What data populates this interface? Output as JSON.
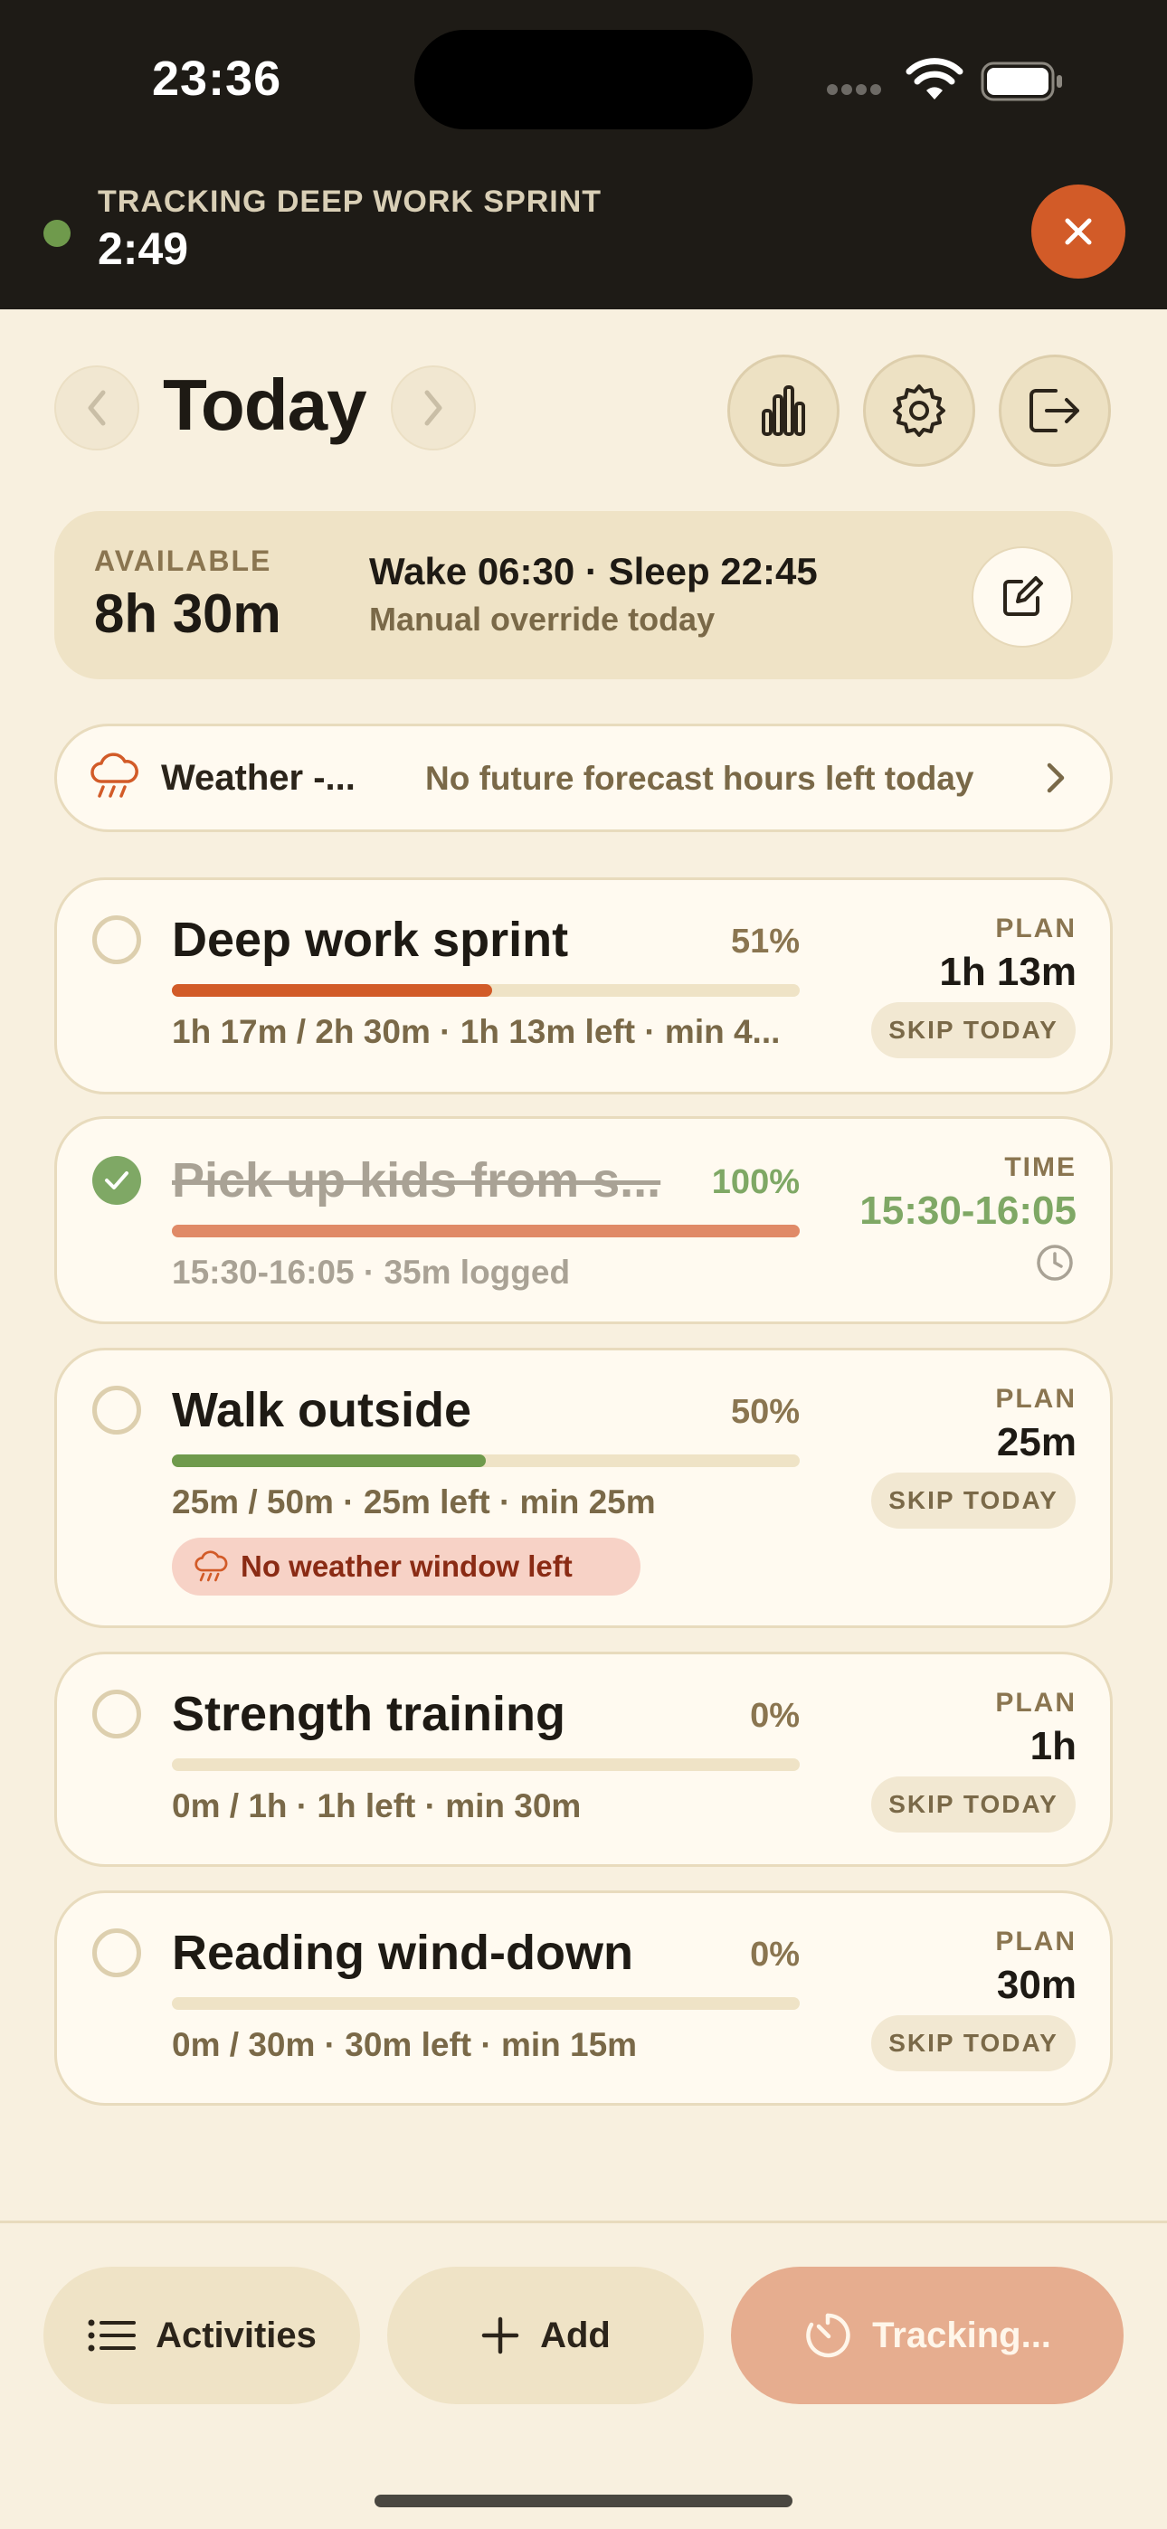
{
  "status_bar": {
    "time": "23:36"
  },
  "tracking_banner": {
    "label": "TRACKING DEEP WORK SPRINT",
    "elapsed": "2:49",
    "accent": "#d25b28"
  },
  "header": {
    "title": "Today",
    "icons": [
      "chevron-left-icon",
      "chevron-right-icon",
      "bar-chart-icon",
      "gear-icon",
      "logout-icon"
    ]
  },
  "availability": {
    "label": "AVAILABLE",
    "value": "8h 30m",
    "schedule": "Wake 06:30 · Sleep 22:45",
    "note": "Manual override today"
  },
  "weather": {
    "title": "Weather -...",
    "message": "No future forecast hours left today"
  },
  "activities": [
    {
      "name": "Deep work sprint",
      "percent": "51%",
      "progress": 0.51,
      "bar_color": "#d25b28",
      "meta": "1h 17m / 2h 30m · 1h 13m left · min 4...",
      "right_label": "PLAN",
      "right_value": "1h 13m",
      "skip_label": "SKIP TODAY",
      "done": false
    },
    {
      "name": "Pick up kids from s...",
      "percent": "100%",
      "progress": 1.0,
      "bar_color": "#e08a67",
      "meta": "15:30-16:05 · 35m logged",
      "right_label": "TIME",
      "right_value": "15:30-16:05",
      "done": true
    },
    {
      "name": "Walk outside",
      "percent": "50%",
      "progress": 0.5,
      "bar_color": "#6f9a4c",
      "meta": "25m / 50m · 25m left · min 25m",
      "warning": "No weather window left",
      "right_label": "PLAN",
      "right_value": "25m",
      "skip_label": "SKIP TODAY",
      "done": false
    },
    {
      "name": "Strength training",
      "percent": "0%",
      "progress": 0,
      "bar_color": "#d25b28",
      "meta": "0m / 1h · 1h left · min 30m",
      "right_label": "PLAN",
      "right_value": "1h",
      "skip_label": "SKIP TODAY",
      "done": false
    },
    {
      "name": "Reading wind-down",
      "percent": "0%",
      "progress": 0,
      "bar_color": "#d25b28",
      "meta": "0m / 30m · 30m left · min 15m",
      "right_label": "PLAN",
      "right_value": "30m",
      "skip_label": "SKIP TODAY",
      "done": false
    }
  ],
  "bottom_bar": {
    "activities_label": "Activities",
    "add_label": "Add",
    "tracking_label": "Tracking..."
  }
}
